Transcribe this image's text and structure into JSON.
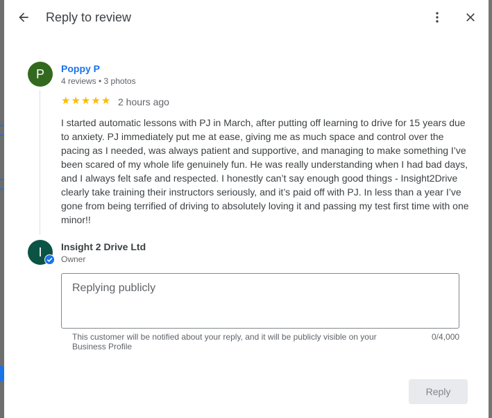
{
  "header": {
    "title": "Reply to review"
  },
  "icons": {
    "back": "arrow-back-icon",
    "more": "more-vert-icon",
    "close": "close-icon",
    "verified": "verified-check-icon"
  },
  "review": {
    "avatar_letter": "P",
    "avatar_color": "#33691e",
    "name": "Poppy P",
    "meta": "4 reviews • 3 photos",
    "rating": 5,
    "stars": [
      "★",
      "★",
      "★",
      "★",
      "★"
    ],
    "time": "2 hours ago",
    "text": "I started automatic lessons with PJ in March, after putting off learning to drive for 15 years due to anxiety. PJ immediately put me at ease, giving me as much space and control over the pacing as I needed, was always patient and supportive, and managing to make something I’ve been scared of my whole life genuinely fun. He was really understanding when I had bad days, and I always felt safe and respected. I honestly can’t say enough good things - Insight2Drive clearly take training their instructors seriously, and it’s paid off with PJ. In less than a year I’ve gone from being terrified of driving to absolutely loving it and passing my test first time with one minor!!"
  },
  "owner": {
    "avatar_letter": "I",
    "avatar_color": "#0b5345",
    "name": "Insight 2 Drive Ltd",
    "role": "Owner"
  },
  "reply": {
    "placeholder": "Replying publicly",
    "value": "",
    "helper": "This customer will be notified about your reply, and it will be publicly visible on your Business Profile",
    "char_count": "0/4,000",
    "submit_label": "Reply"
  },
  "colors": {
    "accent": "#1a73e8",
    "star": "#fbbc04",
    "disabled_button_bg": "#e8eaed"
  }
}
